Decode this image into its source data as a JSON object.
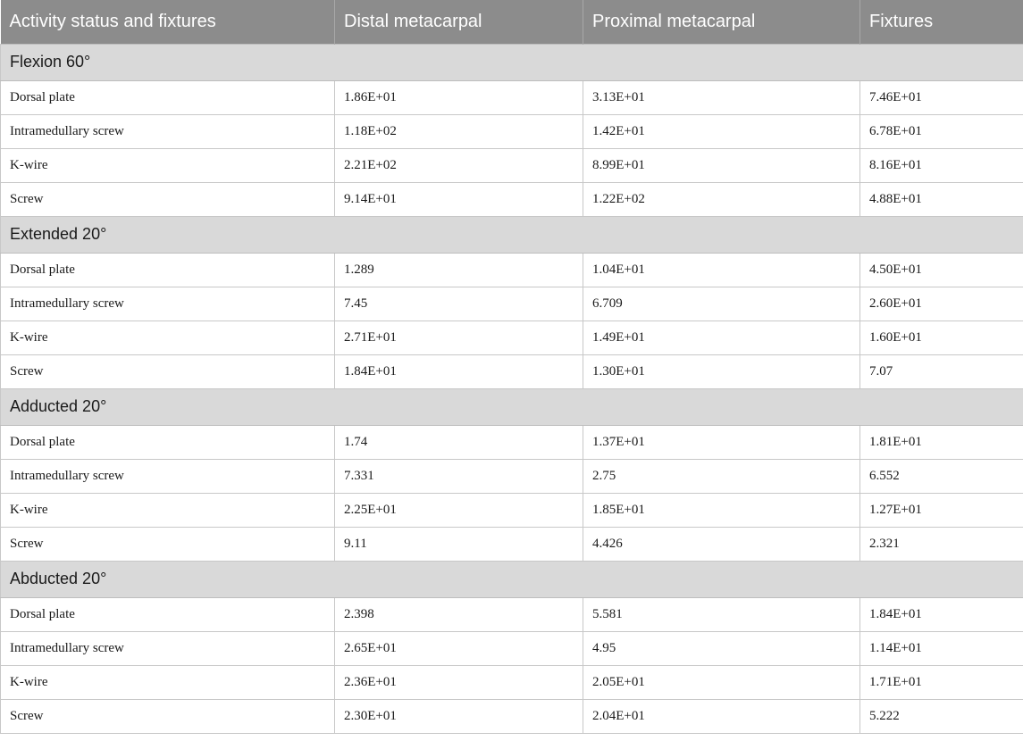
{
  "header": [
    "Activity status and fixtures",
    "Distal metacarpal",
    "Proximal metacarpal",
    "Fixtures"
  ],
  "sections": [
    {
      "title": "Flexion 60°",
      "rows": [
        [
          "Dorsal plate",
          "1.86E+01",
          "3.13E+01",
          "7.46E+01"
        ],
        [
          "Intramedullary screw",
          "1.18E+02",
          "1.42E+01",
          "6.78E+01"
        ],
        [
          "K-wire",
          "2.21E+02",
          "8.99E+01",
          "8.16E+01"
        ],
        [
          "Screw",
          "9.14E+01",
          "1.22E+02",
          "4.88E+01"
        ]
      ]
    },
    {
      "title": "Extended 20°",
      "rows": [
        [
          "Dorsal plate",
          "1.289",
          "1.04E+01",
          "4.50E+01"
        ],
        [
          "Intramedullary screw",
          "7.45",
          "6.709",
          "2.60E+01"
        ],
        [
          "K-wire",
          "2.71E+01",
          "1.49E+01",
          "1.60E+01"
        ],
        [
          "Screw",
          "1.84E+01",
          "1.30E+01",
          "7.07"
        ]
      ]
    },
    {
      "title": "Adducted 20°",
      "rows": [
        [
          "Dorsal plate",
          "1.74",
          "1.37E+01",
          "1.81E+01"
        ],
        [
          "Intramedullary screw",
          "7.331",
          "2.75",
          "6.552"
        ],
        [
          "K-wire",
          "2.25E+01",
          "1.85E+01",
          "1.27E+01"
        ],
        [
          "Screw",
          "9.11",
          "4.426",
          "2.321"
        ]
      ]
    },
    {
      "title": "Abducted 20°",
      "rows": [
        [
          "Dorsal plate",
          "2.398",
          "5.581",
          "1.84E+01"
        ],
        [
          "Intramedullary screw",
          "2.65E+01",
          "4.95",
          "1.14E+01"
        ],
        [
          "K-wire",
          "2.36E+01",
          "2.05E+01",
          "1.71E+01"
        ],
        [
          "Screw",
          "2.30E+01",
          "2.04E+01",
          "5.222"
        ]
      ]
    }
  ]
}
